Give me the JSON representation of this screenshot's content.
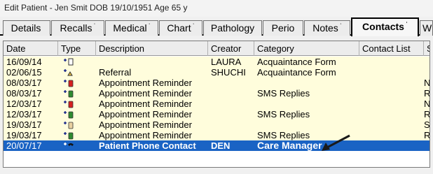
{
  "window": {
    "title": "Edit Patient - Jen Smit DOB 19/10/1951 Age 65 y"
  },
  "tabs": [
    {
      "label": "Details",
      "caret": ""
    },
    {
      "label": "Recalls",
      "caret": "ʿ"
    },
    {
      "label": "Medical",
      "caret": "ʿ"
    },
    {
      "label": "Chart",
      "caret": "ʿ"
    },
    {
      "label": "Pathology",
      "caret": ""
    },
    {
      "label": "Perio",
      "caret": ""
    },
    {
      "label": "Notes",
      "caret": "ʿ"
    },
    {
      "label": "Contacts",
      "caret": "ʿ"
    },
    {
      "label": "W",
      "caret": ""
    }
  ],
  "active_tab": "Contacts",
  "columns": [
    "Date",
    "Type",
    "Description",
    "Creator",
    "Category",
    "Contact List",
    "S"
  ],
  "rows": [
    {
      "date": "16/09/14",
      "type_icon": "document-icon",
      "description": "",
      "creator": "LAURA",
      "category": "Acquaintance Form",
      "contact_list": "",
      "s": ""
    },
    {
      "date": "02/06/15",
      "type_icon": "referral-icon",
      "description": "Referral",
      "creator": "SHUCHI",
      "category": "Acquaintance Form",
      "contact_list": "",
      "s": ""
    },
    {
      "date": "08/03/17",
      "type_icon": "sms-out-icon",
      "description": "Appointment Reminder",
      "creator": "",
      "category": "",
      "contact_list": "",
      "s": "N"
    },
    {
      "date": "08/03/17",
      "type_icon": "sms-in-icon",
      "description": "Appointment Reminder",
      "creator": "",
      "category": "SMS Replies",
      "contact_list": "",
      "s": "R"
    },
    {
      "date": "12/03/17",
      "type_icon": "sms-out-icon",
      "description": "Appointment Reminder",
      "creator": "",
      "category": "",
      "contact_list": "",
      "s": "N"
    },
    {
      "date": "12/03/17",
      "type_icon": "sms-in-icon",
      "description": "Appointment Reminder",
      "creator": "",
      "category": "SMS Replies",
      "contact_list": "",
      "s": "R"
    },
    {
      "date": "19/03/17",
      "type_icon": "sms-out-icon",
      "description": "Appointment Reminder",
      "creator": "",
      "category": "",
      "contact_list": "",
      "s": "S"
    },
    {
      "date": "19/03/17",
      "type_icon": "sms-in-icon",
      "description": "Appointment Reminder",
      "creator": "",
      "category": "SMS Replies",
      "contact_list": "",
      "s": "R"
    },
    {
      "date": "20/07/17",
      "type_icon": "phone-icon",
      "description": "Patient Phone Contact",
      "creator": "DEN",
      "category": "Care Manager",
      "contact_list": "",
      "s": ""
    }
  ],
  "selected_row": 8,
  "colors": {
    "selected_row": "#1a63c4",
    "row_bg": "#fffddc",
    "sms_out": "#d42020",
    "sms_in": "#2f8a2f",
    "arrow": "#1a1a1a"
  }
}
